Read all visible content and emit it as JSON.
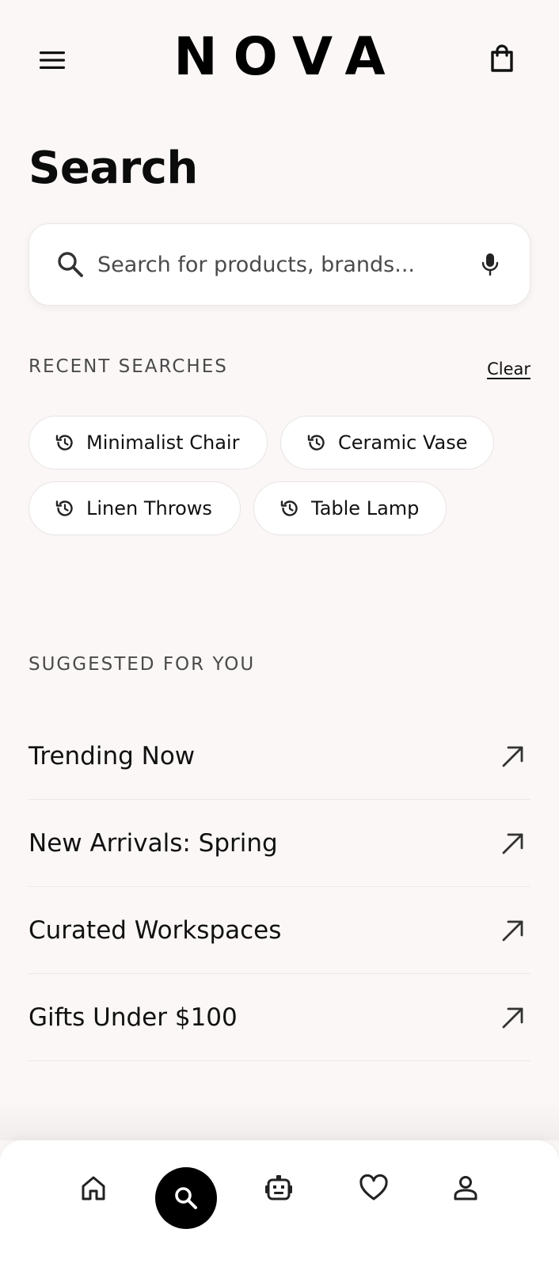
{
  "header": {
    "brand": "NOVA",
    "menu_icon": "hamburger-menu-icon",
    "cart_icon": "shopping-bag-icon"
  },
  "page": {
    "title": "Search"
  },
  "search": {
    "placeholder": "Search for products, brands...",
    "value": "",
    "search_icon": "search-icon",
    "voice_icon": "microphone-icon"
  },
  "recent": {
    "label": "RECENT SEARCHES",
    "clear_label": "Clear",
    "items": [
      {
        "label": "Minimalist Chair",
        "icon": "history-icon"
      },
      {
        "label": "Ceramic Vase",
        "icon": "history-icon"
      },
      {
        "label": "Linen Throws",
        "icon": "history-icon"
      },
      {
        "label": "Table Lamp",
        "icon": "history-icon"
      }
    ]
  },
  "suggested": {
    "label": "SUGGESTED FOR YOU",
    "items": [
      {
        "label": "Trending Now",
        "icon": "arrow-up-right-icon"
      },
      {
        "label": "New Arrivals: Spring",
        "icon": "arrow-up-right-icon"
      },
      {
        "label": "Curated Workspaces",
        "icon": "arrow-up-right-icon"
      },
      {
        "label": "Gifts Under $100",
        "icon": "arrow-up-right-icon"
      }
    ]
  },
  "bottom_nav": {
    "items": [
      {
        "id": "home",
        "icon": "home-icon",
        "active": false
      },
      {
        "id": "search",
        "icon": "search-icon",
        "active": true
      },
      {
        "id": "assistant",
        "icon": "robot-icon",
        "active": false
      },
      {
        "id": "favorites",
        "icon": "heart-icon",
        "active": false
      },
      {
        "id": "profile",
        "icon": "person-icon",
        "active": false
      }
    ]
  },
  "colors": {
    "background": "#faf7f6",
    "surface": "#ffffff",
    "text": "#111111",
    "muted": "#4a4a4a",
    "active_nav": "#000000"
  }
}
